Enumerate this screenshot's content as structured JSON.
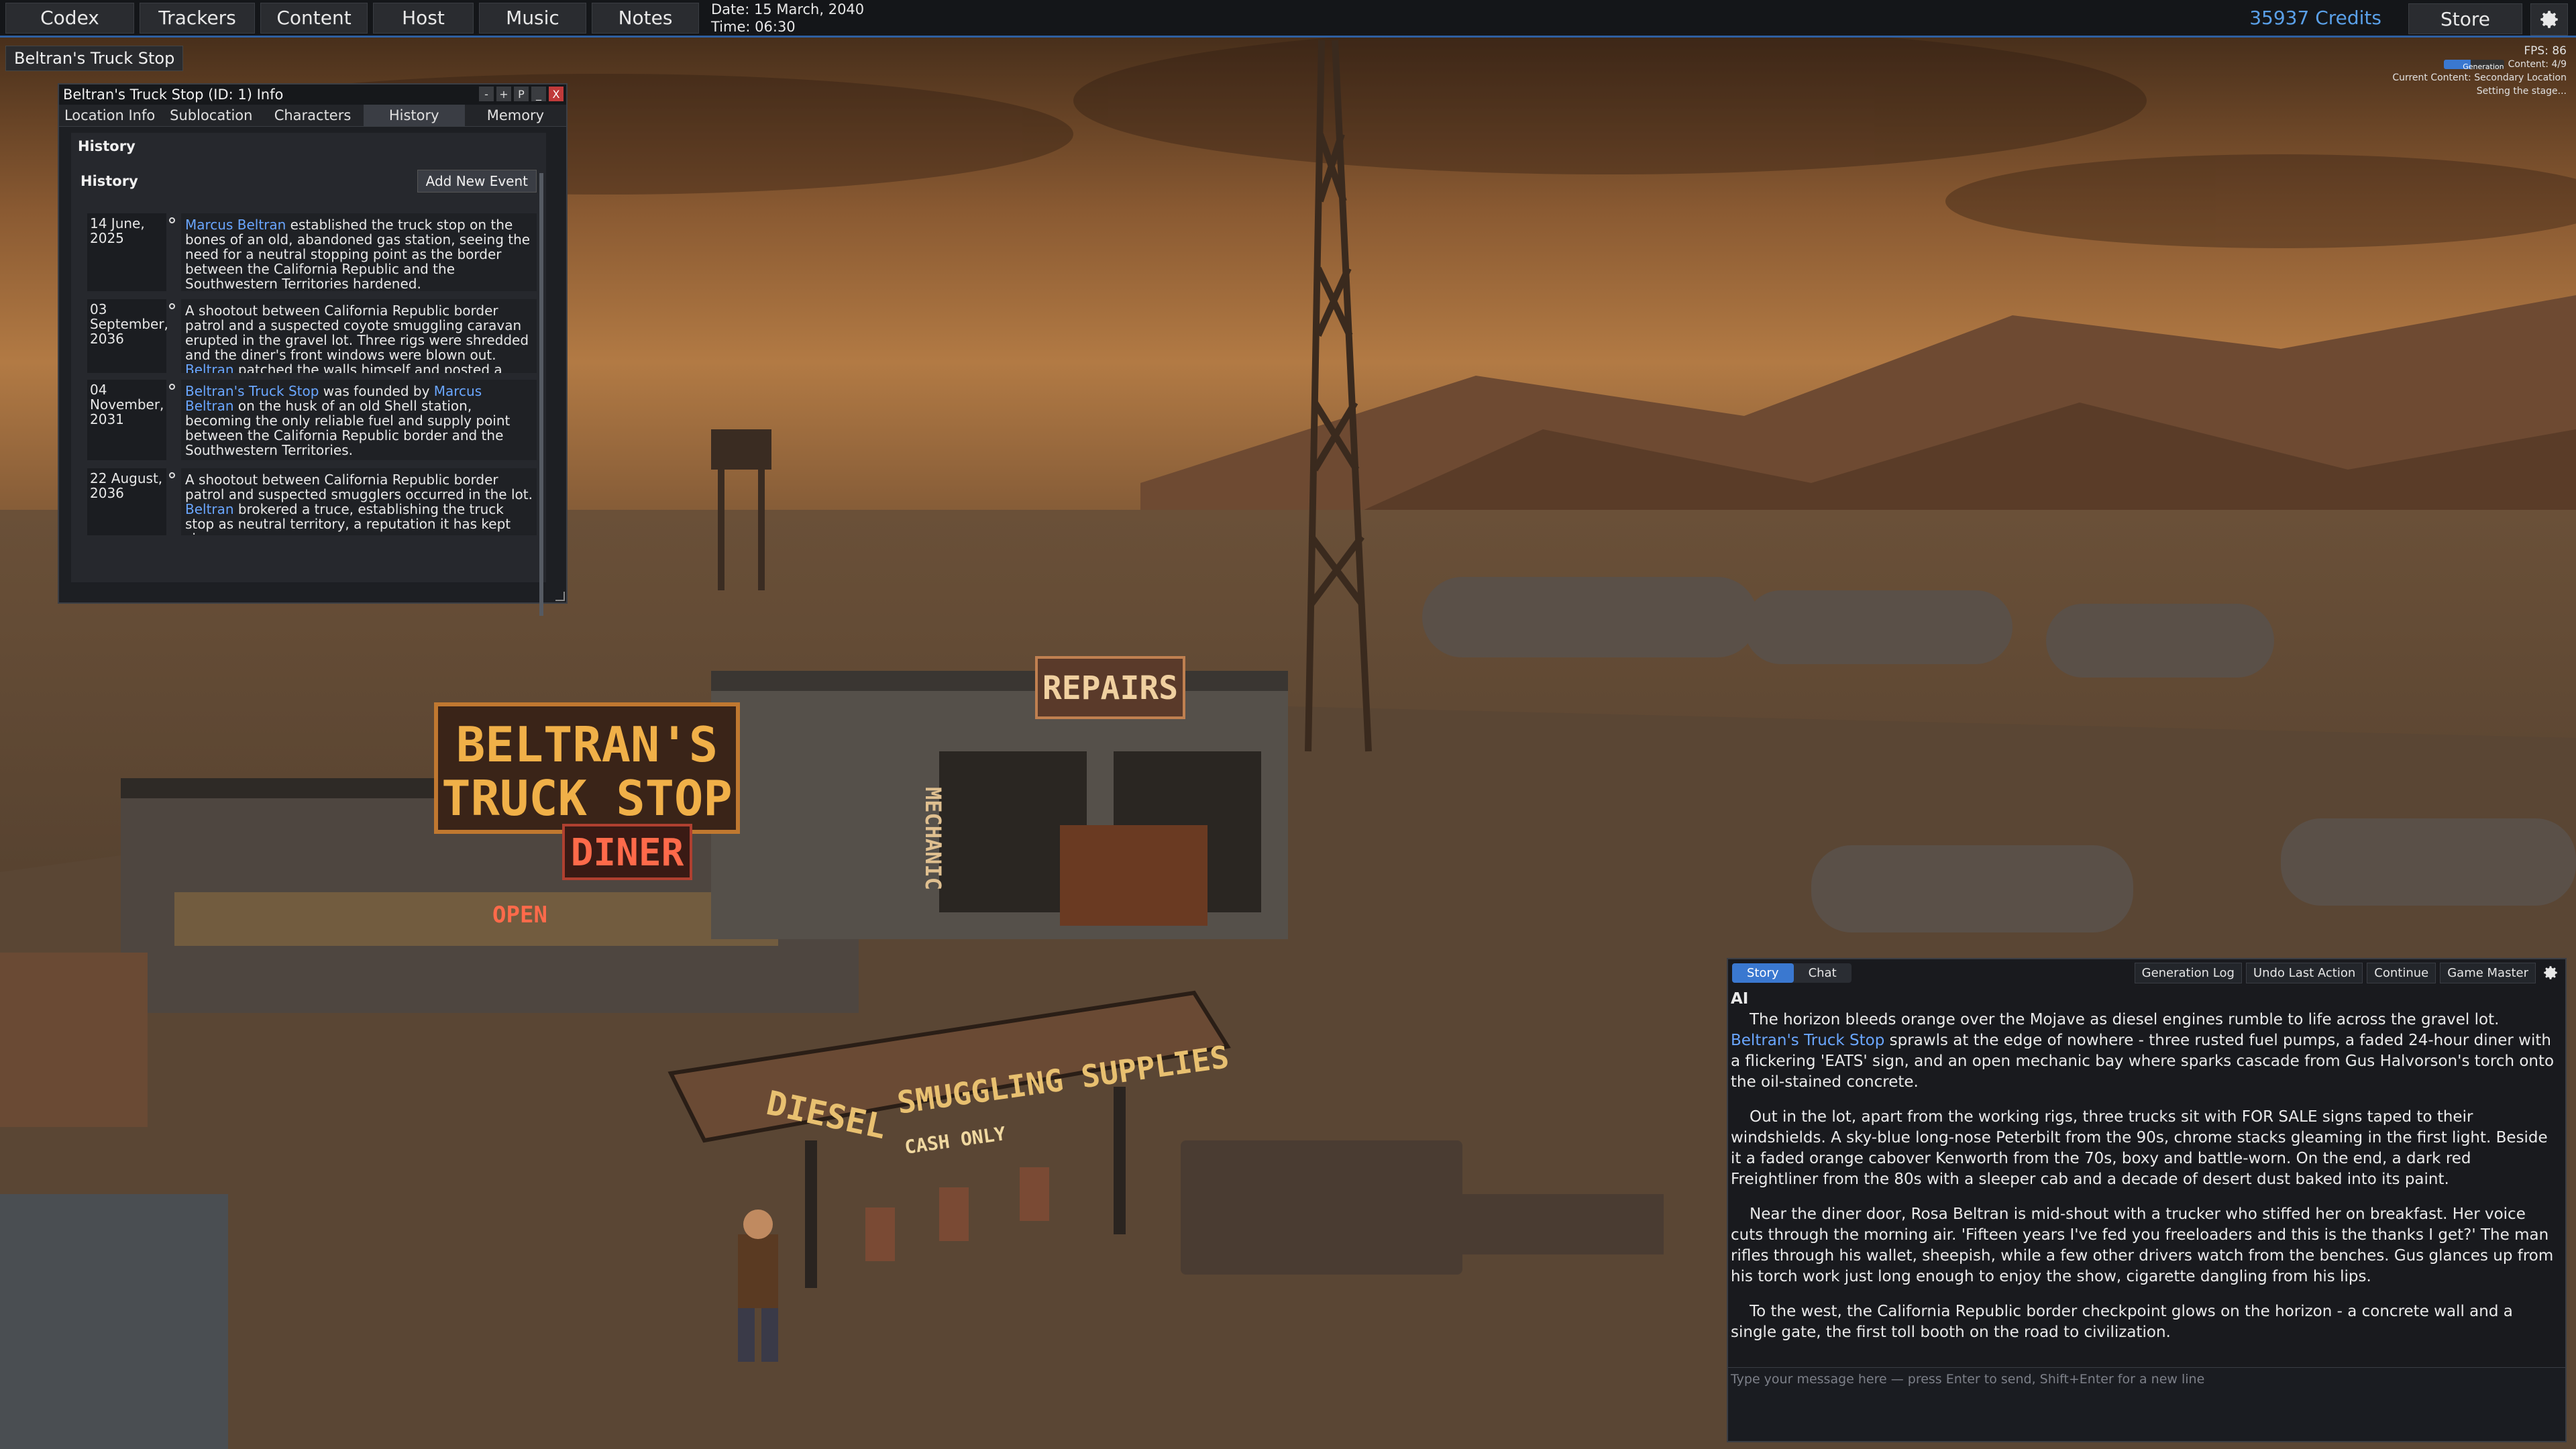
{
  "nav": {
    "items": [
      "Codex",
      "Trackers",
      "Content",
      "Host",
      "Music",
      "Notes"
    ],
    "date": "Date: 15 March, 2040",
    "time": "Time: 06:30",
    "credits": "35937 Credits",
    "store": "Store"
  },
  "location_tag": "Beltran's Truck Stop",
  "status": {
    "fps": "FPS: 86",
    "generation_label": "Generation",
    "generation_progress": 0.45,
    "content_count": "Content: 4/9",
    "current_content": "Current Content: Secondary Location",
    "stage": "Setting the stage..."
  },
  "info_window": {
    "title": "Beltran's Truck Stop (ID: 1) Info",
    "buttons": [
      "-",
      "+",
      "P",
      "_",
      "X"
    ],
    "tabs": [
      "Location Info",
      "Sublocation",
      "Characters",
      "History",
      "Memory"
    ],
    "active_tab": "History",
    "section_title": "History",
    "sub_title": "History",
    "add_event": "Add New Event",
    "events": [
      {
        "date": "14 June, 2025",
        "segments": [
          {
            "t": "Marcus Beltran",
            "ent": true
          },
          {
            "t": " established the truck stop on the bones of an old, abandoned gas station, seeing the need for a neutral stopping point as the border between the California Republic and the Southwestern Territories hardened.",
            "ent": false
          }
        ]
      },
      {
        "date": "03 September, 2036",
        "segments": [
          {
            "t": "A shootout between California Republic border patrol and a suspected coyote smuggling caravan erupted in the gravel lot. Three rigs were shredded and the diner's front windows were blown out. ",
            "ent": false
          },
          {
            "t": "Beltran",
            "ent": true
          },
          {
            "t": " patched the walls himself and posted a sign: 'No guns inside. No exceptions.'",
            "ent": false
          }
        ]
      },
      {
        "date": "04 November, 2031",
        "segments": [
          {
            "t": "Beltran's Truck Stop",
            "ent": true
          },
          {
            "t": " was founded by ",
            "ent": false
          },
          {
            "t": "Marcus Beltran",
            "ent": true
          },
          {
            "t": " on the husk of an old Shell station, becoming the only reliable fuel and supply point between the California Republic border and the Southwestern Territories.",
            "ent": false
          }
        ]
      },
      {
        "date": "22 August, 2036",
        "segments": [
          {
            "t": "A shootout between California Republic border patrol and suspected smugglers occurred in the lot. ",
            "ent": false
          },
          {
            "t": "Beltran",
            "ent": true
          },
          {
            "t": " brokered a truce, establishing the truck stop as neutral territory, a reputation it has kept since.",
            "ent": false
          }
        ]
      }
    ]
  },
  "story_panel": {
    "tabs": [
      "Story",
      "Chat"
    ],
    "active_tab": "Story",
    "actions": [
      "Generation Log",
      "Undo Last Action",
      "Continue",
      "Game Master"
    ],
    "speaker": "AI",
    "paragraphs": [
      [
        {
          "t": "The horizon bleeds orange over the Mojave as diesel engines rumble to life across the gravel lot. ",
          "ent": false
        },
        {
          "t": "Beltran's Truck Stop",
          "ent": true
        },
        {
          "t": " sprawls at the edge of nowhere - three rusted fuel pumps, a faded 24-hour diner with a flickering 'EATS' sign, and an open mechanic bay where sparks cascade from Gus Halvorson's torch onto the oil-stained concrete.",
          "ent": false
        }
      ],
      [
        {
          "t": "Out in the lot, apart from the working rigs, three trucks sit with FOR SALE signs taped to their windshields. A sky-blue long-nose Peterbilt from the 90s, chrome stacks gleaming in the first light. Beside it a faded orange cabover Kenworth from the 70s, boxy and battle-worn. On the end, a dark red Freightliner from the 80s with a sleeper cab and a decade of desert dust baked into its paint.",
          "ent": false
        }
      ],
      [
        {
          "t": "Near the diner door, Rosa Beltran is mid-shout with a trucker who stiffed her on breakfast. Her voice cuts through the morning air. 'Fifteen years I've fed you freeloaders and this is the thanks I get?' The man rifles through his wallet, sheepish, while a few other drivers watch from the benches. Gus glances up from his torch work just long enough to enjoy the show, cigarette dangling from his lips.",
          "ent": false
        }
      ],
      [
        {
          "t": "To the west, the California Republic border checkpoint glows on the horizon - a concrete wall and a single gate, the first toll booth on the road to civilization.",
          "ent": false
        }
      ]
    ],
    "input_placeholder": "Type your message here  —  press Enter to send, Shift+Enter for a new line"
  },
  "scene_signs": {
    "main_sign_line1": "BELTRAN'S",
    "main_sign_line2": "TRUCK STOP",
    "diner": "DINER",
    "open": "OPEN",
    "repairs": "REPAIRS",
    "mechanic": "MECHANIC",
    "diesel": "DIESEL",
    "smuggling": "SMUGGLING SUPPLIES",
    "cash_only": "CASH ONLY"
  }
}
